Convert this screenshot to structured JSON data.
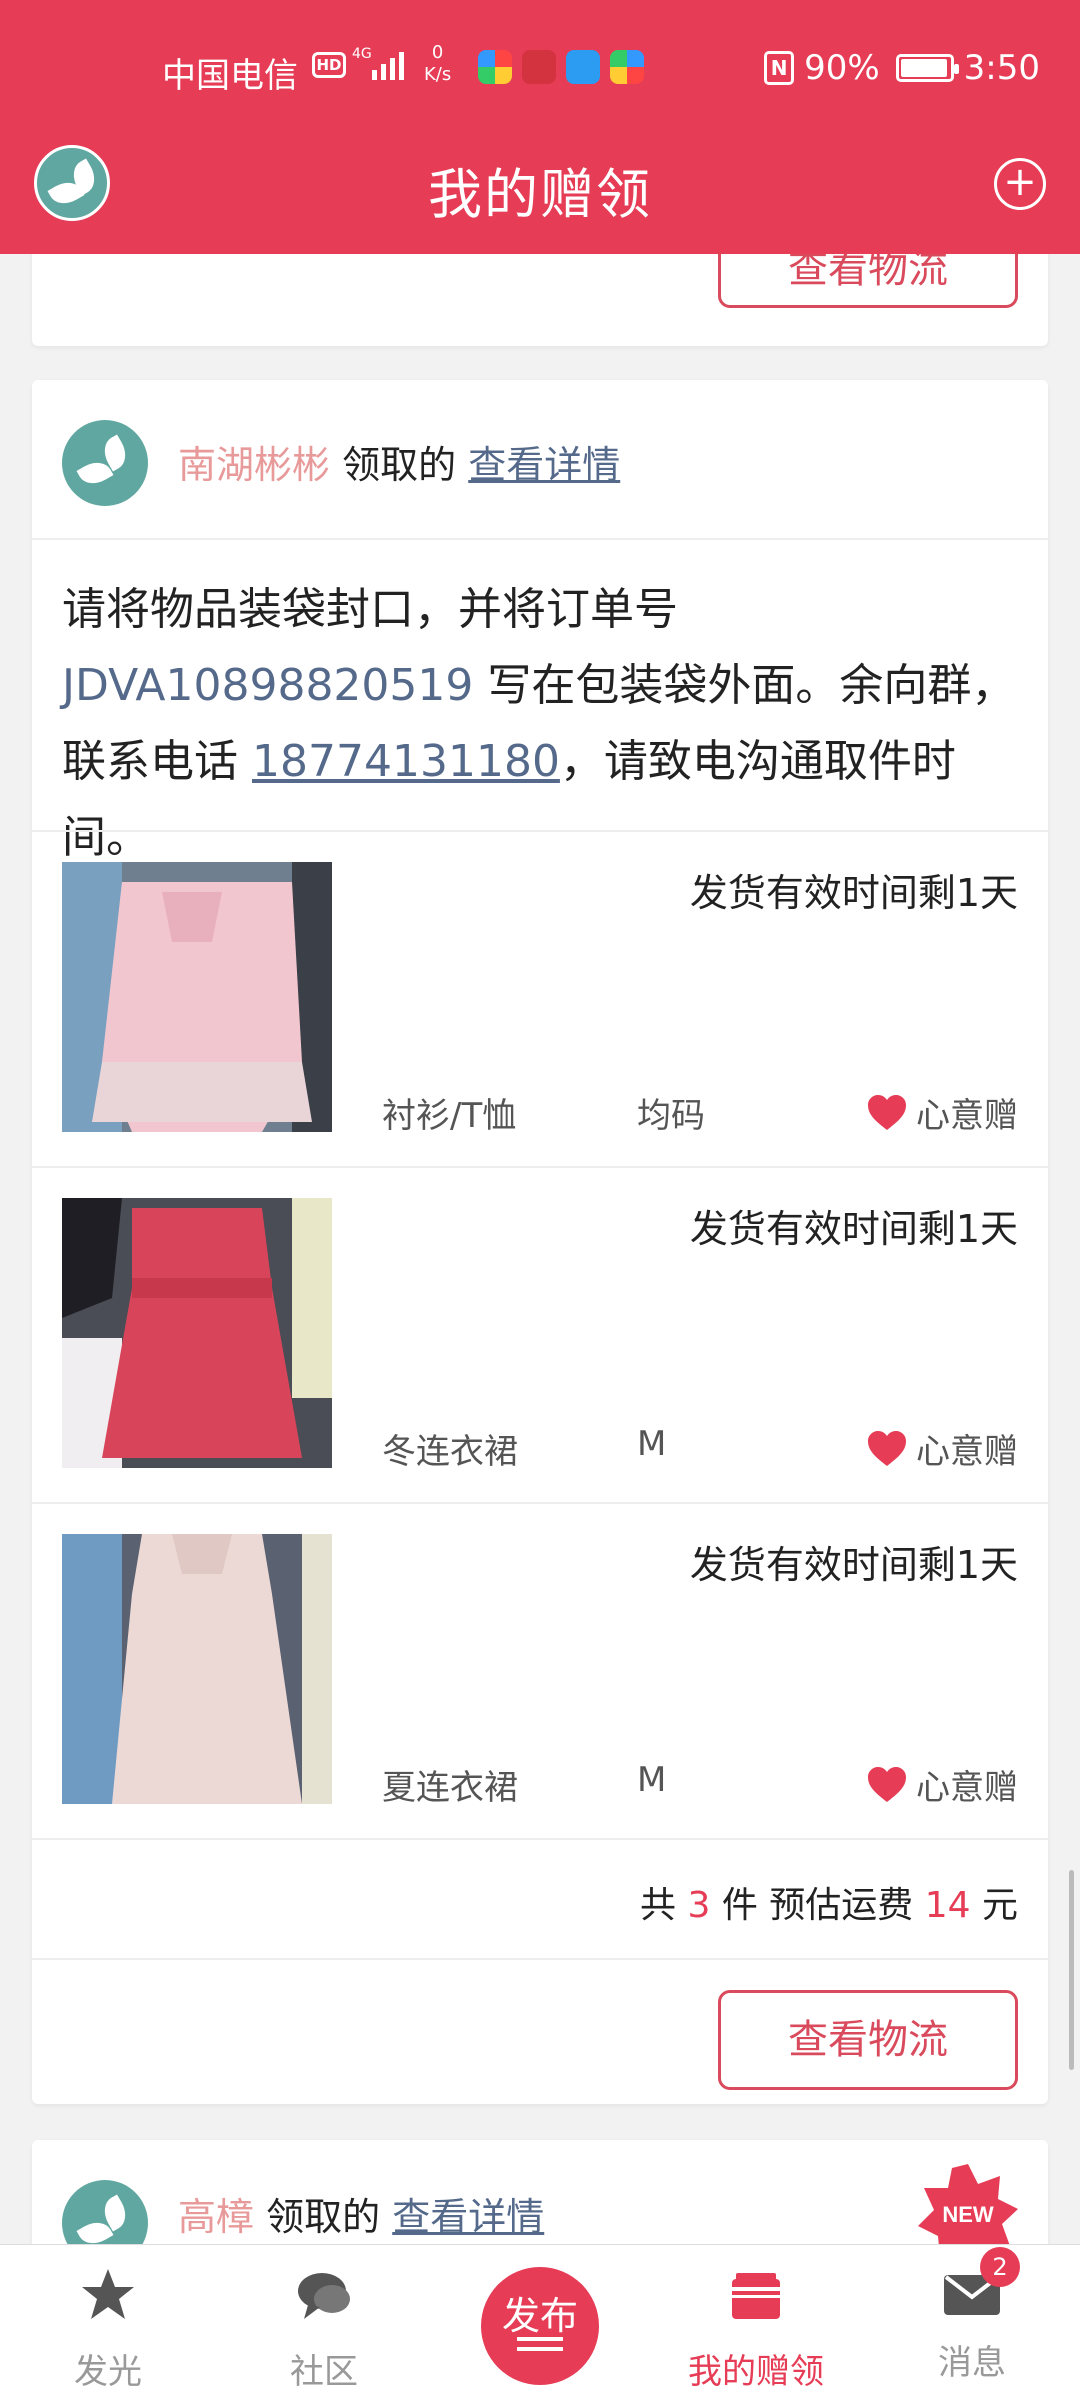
{
  "status_bar": {
    "carrier": "中国电信",
    "hd": "HD",
    "network": "4G",
    "speed_value": "0",
    "speed_unit": "K/s",
    "battery": "90%",
    "time": "3:50",
    "nfc": "N"
  },
  "header": {
    "title": "我的赠领",
    "plus": "+"
  },
  "prev_card": {
    "button": "查看物流"
  },
  "card": {
    "user": "南湖彬彬",
    "verb": "领取的",
    "detail_link": "查看详情",
    "notice": {
      "p1": "请将物品装袋封口，并将订单号 ",
      "order": "JDVA10898820519",
      "p2": " 写在包装袋外面。余向群，联系电话 ",
      "phone": "18774131180",
      "p3": "，请致电沟通取件时间。"
    },
    "items": [
      {
        "deadline": "发货有效时间剩1天",
        "category": "衬衫/T恤",
        "size": "均码",
        "gift": "心意赠"
      },
      {
        "deadline": "发货有效时间剩1天",
        "category": "冬连衣裙",
        "size": "M",
        "gift": "心意赠"
      },
      {
        "deadline": "发货有效时间剩1天",
        "category": "夏连衣裙",
        "size": "M",
        "gift": "心意赠"
      }
    ],
    "summary": {
      "total_prefix": "共 ",
      "count": "3",
      "mid": " 件 预估运费 ",
      "fee": "14",
      "unit": " 元"
    },
    "button": "查看物流"
  },
  "next_card": {
    "user": "高樟",
    "verb": "领取的",
    "detail_link": "查看详情",
    "badge": "NEW"
  },
  "bottom_nav": {
    "items": [
      {
        "label": "发光"
      },
      {
        "label": "社区"
      },
      {
        "label": "发布"
      },
      {
        "label": "我的赠领"
      },
      {
        "label": "消息"
      }
    ],
    "message_badge": "2"
  },
  "colors": {
    "brand": "#e63c55",
    "link": "#556a8b",
    "username": "#e89a9a"
  }
}
